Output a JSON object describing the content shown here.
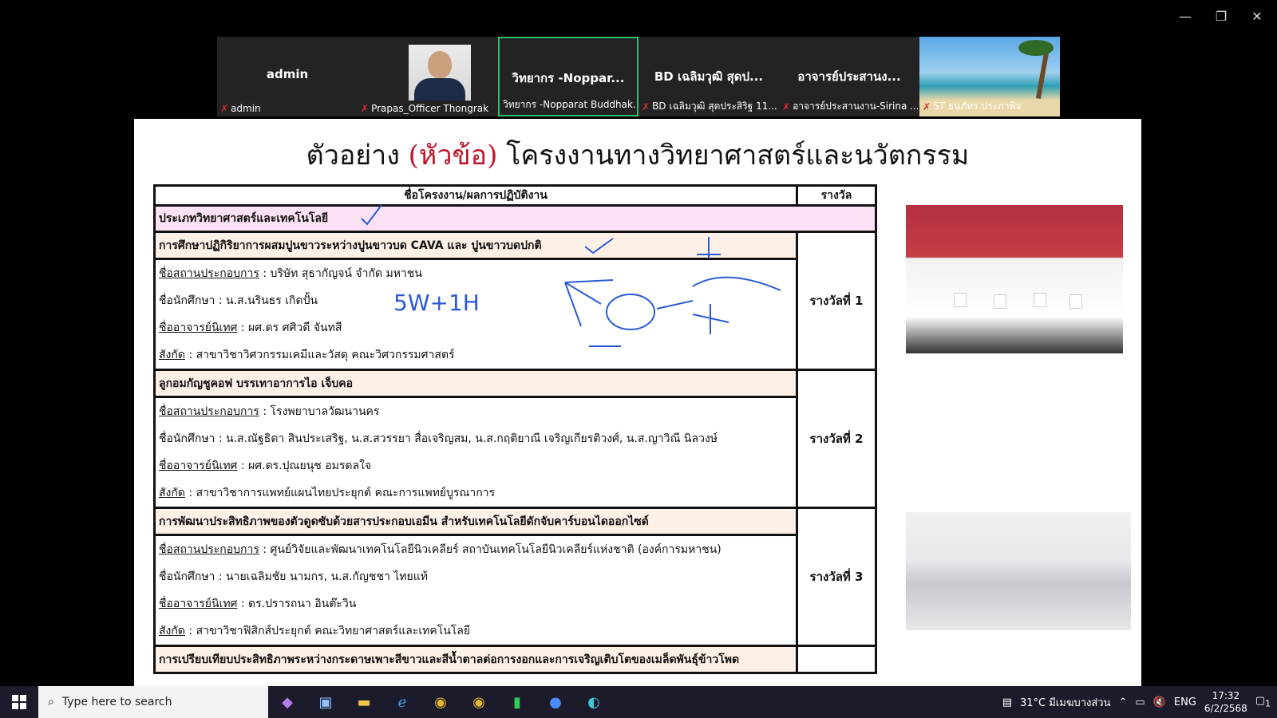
{
  "window": {
    "minimize": "—",
    "restore": "❐",
    "close": "✕"
  },
  "participants": [
    {
      "big": "admin",
      "label": "admin",
      "type": "name"
    },
    {
      "big": "",
      "label": "Prapas_Officer Thongrak",
      "type": "photo"
    },
    {
      "big": "วิทยากร -Noppar...",
      "label": "วิทยากร -Nopparat Buddhak...",
      "type": "name",
      "active": true
    },
    {
      "big": "BD เฉลิมวุฒิ สุดป...",
      "label": "BD เฉลิมวุฒิ สุดประสิริฐ 11...",
      "type": "name"
    },
    {
      "big": "อาจารย์ประสานง...",
      "label": "อาจารย์ประสานงาน-Sirina ...",
      "type": "name"
    },
    {
      "big": "",
      "label": "ST ธนภัทร ประภาพิจ",
      "type": "beach"
    }
  ],
  "slide": {
    "title_pre": "ตัวอย่าง ",
    "title_red": "(หัวข้อ)",
    "title_post": " โครงงานทางวิทยาศาสตร์และนวัตกรรม",
    "col_project": "ชื่อโครงงาน/ผลการปฏิบัติงาน",
    "col_award": "รางวัล",
    "category": "ประเภทวิทยาศาสตร์และเทคโนโลยี",
    "projects": [
      {
        "title": "การศึกษาปฏิกิริยาการผสมปูนขาวระหว่างปูนขาวบด CAVA และ ปูนขาวบดปกติ",
        "org_label": "ชื่อสถานประกอบการ",
        "org": " :  บริษัท สุธากัญจน์ จำกัด มหาชน",
        "student_label": "ชื่อนักศึกษา",
        "students": " : น.ส.นรินธร  เกิดปั้น",
        "advisor_label": "ชื่ออาจารย์นิเทศ",
        "advisor": " :  ผศ.ดร ศศิวดี  จันทสี",
        "affil_label": "สังกัด",
        "affil": " :  สาขาวิชาวิศวกรรมเคมีและวัสดุ  คณะวิศวกรรมศาสตร์",
        "award": "รางวัลที่ 1"
      },
      {
        "title": "ลูกอมกัญชูคอฟ บรรเทาอาการไอ เจ็บคอ",
        "org_label": "ชื่อสถานประกอบการ",
        "org": " :  โรงพยาบาลวัฒนานคร",
        "student_label": "ชื่อนักศึกษา",
        "students": " :  น.ส.ณัฐธิดา  สินประเสริฐ, น.ส.สวรรยา  สื่อเจริญสม, น.ส.กฤติยาณี  เจริญเกียรติวงศ์, น.ส.ญาวิณี  นิลวงษ์",
        "advisor_label": "ชื่ออาจารย์นิเทศ",
        "advisor": " :  ผศ.ดร.ปุณยนุช  อมรดลใจ",
        "affil_label": "สังกัด",
        "affil": " : สาขาวิชาการแพทย์แผนไทยประยุกต์  คณะการแพทย์บูรณาการ",
        "award": "รางวัลที่ 2"
      },
      {
        "title": "การพัฒนาประสิทธิภาพของตัวดูดซับด้วยสารประกอบเอมีน สำหรับเทคโนโลยีดักจับคาร์บอนไดออกไซด์",
        "org_label": "ชื่อสถานประกอบการ",
        "org": " :  ศูนย์วิจัยและพัฒนาเทคโนโลยีนิวเคลียร์  สถาบันเทคโนโลยีนิวเคลียร์แห่งชาติ (องค์การมหาชน)",
        "student_label": "ชื่อนักศึกษา",
        "students": " :  นายเฉลิมชัย  นามกร, น.ส.กัญชชา  ไทยแท้",
        "advisor_label": "ชื่ออาจารย์นิเทศ",
        "advisor": " :   ดร.ปรารถนา  อินต๊ะวิน",
        "affil_label": "สังกัด",
        "affil": " :  สาขาวิชาฟิสิกส์ประยุกต์  คณะวิทยาศาสตร์และเทคโนโลยี",
        "award": "รางวัลที่ 3"
      }
    ],
    "last_title": "การเปรียบเทียบประสิทธิภาพระหว่างกระดาษเพาะสีขาวและสีน้ำตาลต่อการงอกและการเจริญเติบโตของเมล็ดพันธุ์ข้าวโพด",
    "annotation": "5W+1H"
  },
  "taskbar": {
    "search_placeholder": "Type here to search",
    "weather": "31°C  มีเมฆบางส่วน",
    "lang": "ENG",
    "time": "17:32",
    "date": "6/2/2568",
    "notif_count": "1"
  }
}
